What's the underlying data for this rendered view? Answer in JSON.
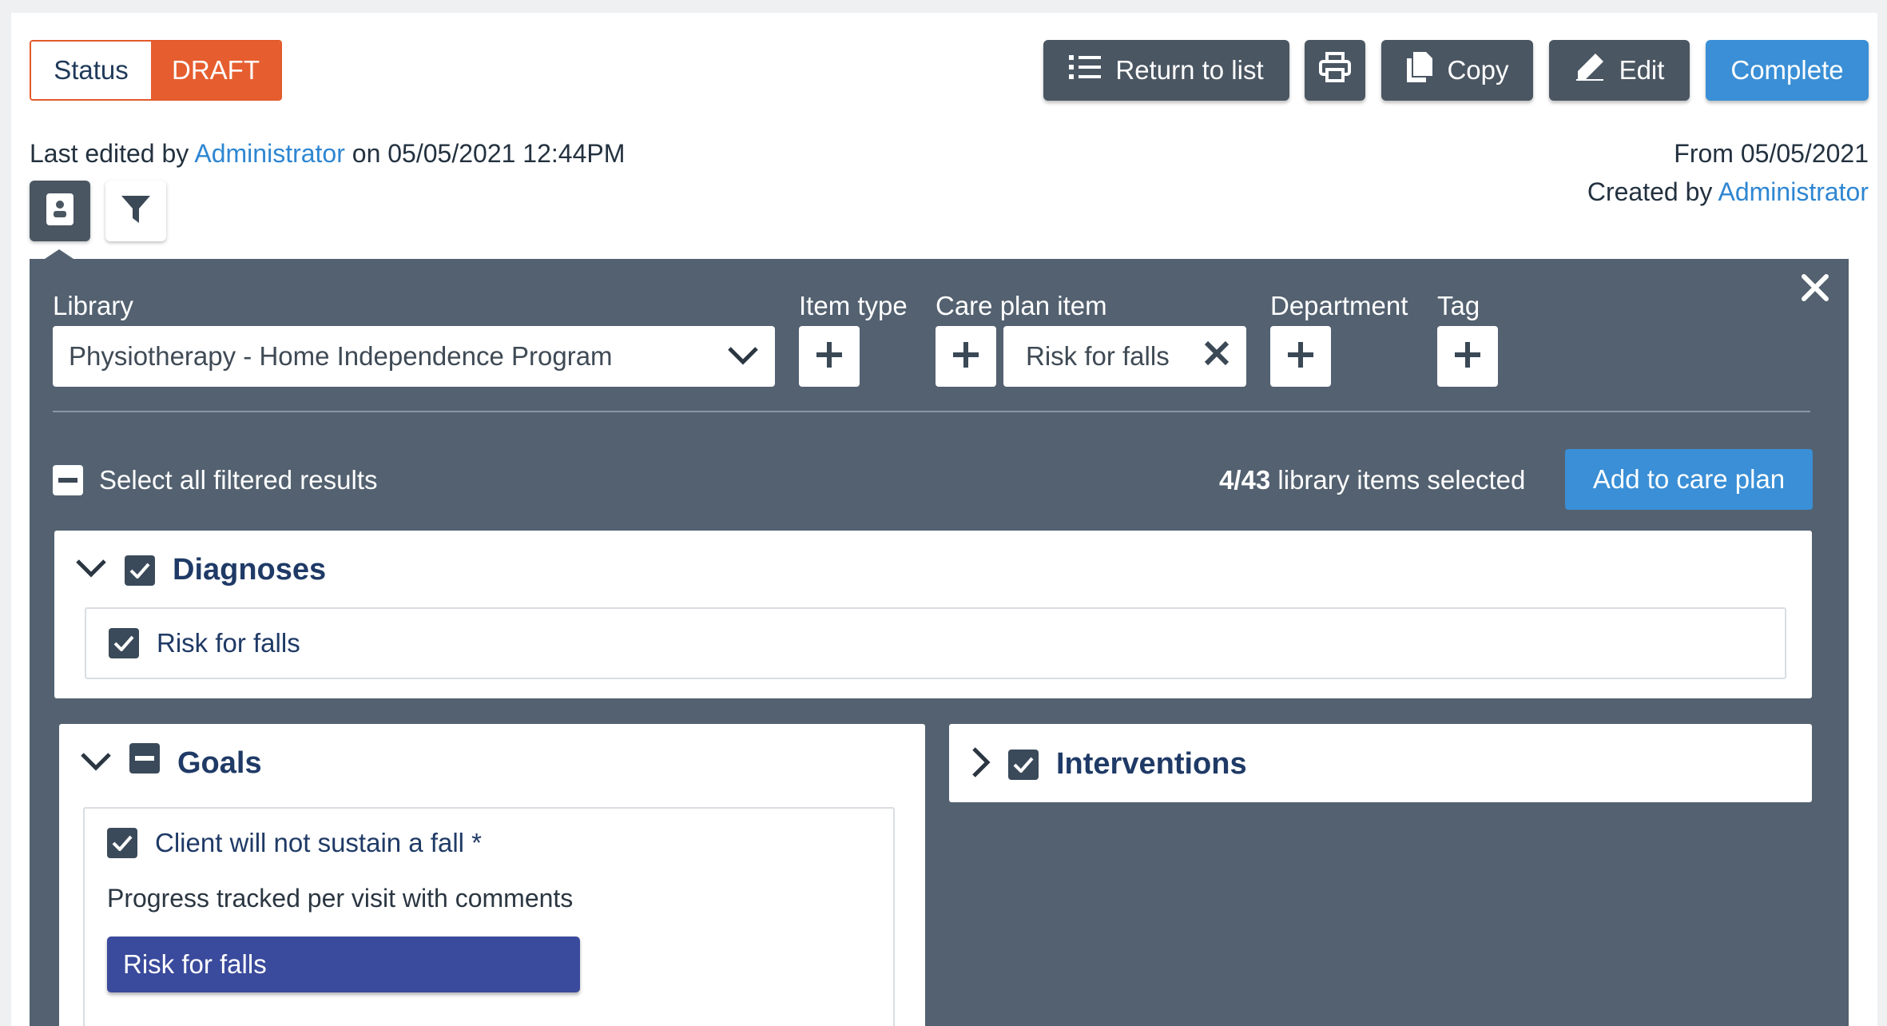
{
  "header": {
    "status_label": "Status",
    "status_value": "DRAFT",
    "buttons": {
      "return": "Return to list",
      "copy": "Copy",
      "edit": "Edit",
      "complete": "Complete"
    },
    "last_edited_prefix": "Last edited by",
    "last_edited_user": "Administrator",
    "last_edited_suffix": "on 05/05/2021 12:44PM",
    "from": "From 05/05/2021",
    "created_prefix": "Created by",
    "created_user": "Administrator"
  },
  "filters": {
    "library_label": "Library",
    "library_value": "Physiotherapy - Home Independence Program",
    "item_type_label": "Item type",
    "care_plan_item_label": "Care plan item",
    "care_plan_item_chip": "Risk for falls",
    "department_label": "Department",
    "tag_label": "Tag"
  },
  "selection": {
    "select_all": "Select all filtered results",
    "count": "4/43",
    "count_suffix": "library items selected",
    "add_button": "Add to care plan"
  },
  "sections": {
    "diagnoses": {
      "title": "Diagnoses",
      "items": [
        "Risk for falls"
      ]
    },
    "goals": {
      "title": "Goals",
      "item_title": "Client will not sustain a fall *",
      "item_desc": "Progress tracked per visit with comments",
      "item_tag": "Risk for falls"
    },
    "interventions": {
      "title": "Interventions"
    }
  },
  "colors": {
    "draft": "#e65e2f",
    "primary": "#3a8fd6",
    "dark_button": "#4a5662",
    "panel": "#536170",
    "tag": "#3a4a9c"
  }
}
